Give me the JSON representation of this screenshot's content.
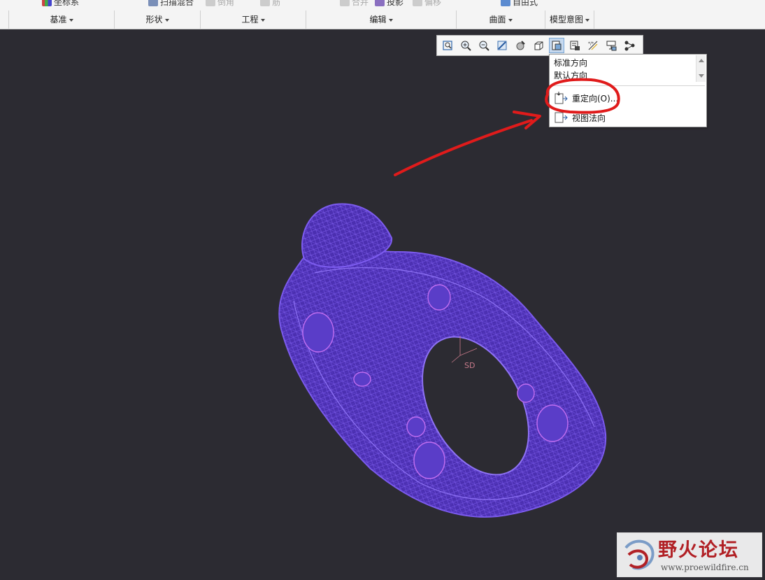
{
  "ribbon": {
    "top_items": [
      {
        "label": "坐标系",
        "dim": false
      },
      {
        "label": "扫描混合",
        "dim": false
      },
      {
        "label": "倒角",
        "dim": true
      },
      {
        "label": "筋",
        "dim": true
      },
      {
        "label": "合并",
        "dim": true
      },
      {
        "label": "投影",
        "dim": false
      },
      {
        "label": "偏移",
        "dim": true
      },
      {
        "label": "自由式",
        "dim": false
      }
    ],
    "groups": [
      "基准",
      "形状",
      "工程",
      "编辑",
      "曲面",
      "模型意图"
    ]
  },
  "view_toolbar": {
    "buttons": [
      "refit-icon",
      "zoom-in-icon",
      "zoom-out-icon",
      "repaint-icon",
      "display-style-icon",
      "view-orientation-icon",
      "saved-orientations-icon",
      "view-manager-icon",
      "datum-display-icon",
      "annotation-display-icon",
      "spin-center-icon"
    ],
    "active_index": 6
  },
  "orientation_menu": {
    "list": [
      "标准方向",
      "默认方向"
    ],
    "items": [
      {
        "label": "重定向(O)...",
        "icon": "reorient-icon"
      },
      {
        "label": "视图法向",
        "icon": "view-normal-icon"
      }
    ]
  },
  "viewport": {
    "csys_label": "SD",
    "background": "#2c2b32",
    "model_color": "#6a4bd6"
  },
  "watermark": {
    "title": "野火论坛",
    "url": "www.proewildfire.cn"
  },
  "colors": {
    "annotation_red": "#e01b1b",
    "active_button": "#c6d9ef"
  }
}
